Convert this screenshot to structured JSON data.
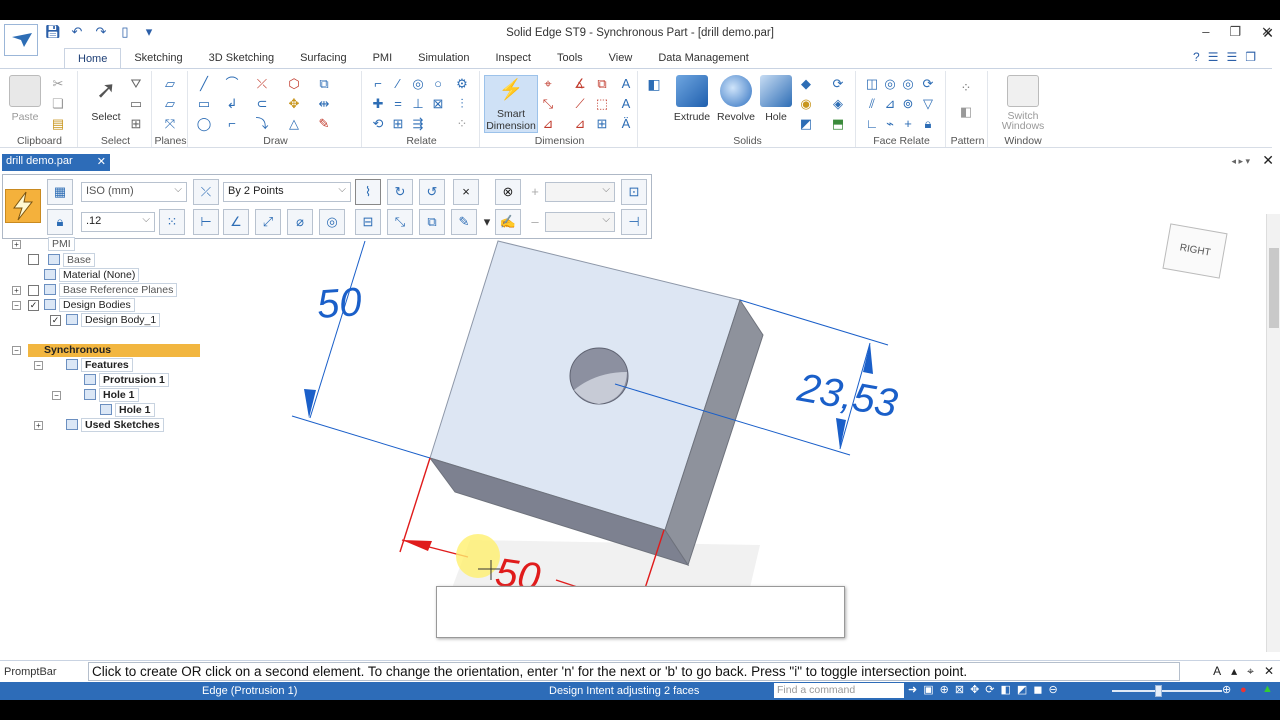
{
  "window": {
    "title": "Solid Edge ST9 - Synchronous Part - [drill demo.par]",
    "controls": [
      "–",
      "❐",
      "✕"
    ]
  },
  "quick_access": [
    "save-icon",
    "undo-icon",
    "redo-icon",
    "new-icon",
    "customize-icon"
  ],
  "tabs": [
    {
      "label": "Home",
      "active": true
    },
    {
      "label": "Sketching"
    },
    {
      "label": "3D Sketching"
    },
    {
      "label": "Surfacing"
    },
    {
      "label": "PMI"
    },
    {
      "label": "Simulation"
    },
    {
      "label": "Inspect"
    },
    {
      "label": "Tools"
    },
    {
      "label": "View"
    },
    {
      "label": "Data Management"
    }
  ],
  "ribbon": {
    "groups": {
      "clipboard": "Clipboard",
      "select": "Select",
      "planes": "Planes",
      "draw": "Draw",
      "relate": "Relate",
      "dimension": "Dimension",
      "solids": "Solids",
      "face_relate": "Face Relate",
      "pattern": "Pattern",
      "window": "Window"
    },
    "buttons": {
      "paste": "Paste",
      "select": "Select",
      "smart_dimension_1": "Smart",
      "smart_dimension_2": "Dimension",
      "extrude": "Extrude",
      "revolve": "Revolve",
      "hole": "Hole",
      "switch_windows_1": "Switch",
      "switch_windows_2": "Windows"
    }
  },
  "document_tab": {
    "label": "drill demo.par",
    "close": "✕"
  },
  "command_bar": {
    "standard": "ISO (mm)",
    "method": "By 2 Points",
    "precision": ".12"
  },
  "tree": {
    "pmi": "PMI",
    "base": "Base",
    "material": "Material (None)",
    "base_reference_planes": "Base Reference Planes",
    "design_bodies": "Design Bodies",
    "design_body_1": "Design Body_1",
    "synchronous": "Synchronous",
    "features": "Features",
    "protrusion_1": "Protrusion 1",
    "hole_1": "Hole 1",
    "hole_1_child": "Hole 1",
    "used_sketches": "Used Sketches"
  },
  "viewport": {
    "dimensions": [
      {
        "value": "50",
        "color": "#1a5fc9"
      },
      {
        "value": "23,53",
        "color": "#1a5fc9"
      },
      {
        "value": "50",
        "color": "#e01b1b"
      }
    ],
    "view_cube_label": "RIGHT"
  },
  "prompt": {
    "label": "PromptBar",
    "text": "Click to create OR click on a second element. To change the orientation, enter 'n' for the next or 'b' to go back.   Press \"i\" to toggle intersection point."
  },
  "status": {
    "left": "Edge (Protrusion 1)",
    "middle": "Design Intent adjusting 2 faces",
    "find_placeholder": "Find a command"
  },
  "colors": {
    "accent": "#2d6cb8",
    "sync_highlight": "#f2b640",
    "dim_blue": "#1a5fc9",
    "dim_red": "#e01b1b"
  }
}
